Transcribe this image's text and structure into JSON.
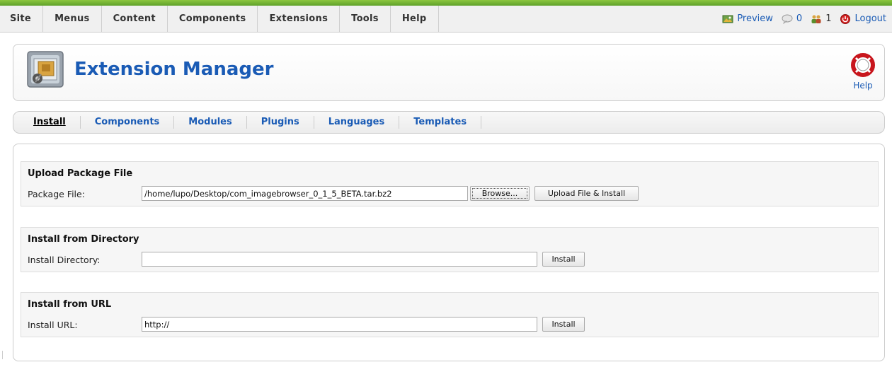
{
  "menubar": {
    "items": [
      "Site",
      "Menus",
      "Content",
      "Components",
      "Extensions",
      "Tools",
      "Help"
    ],
    "preview_label": "Preview",
    "messages_count": "0",
    "users_count": "1",
    "logout_label": "Logout"
  },
  "header": {
    "title": "Extension Manager",
    "help_label": "Help"
  },
  "tabs": [
    "Install",
    "Components",
    "Modules",
    "Plugins",
    "Languages",
    "Templates"
  ],
  "upload": {
    "title": "Upload Package File",
    "label": "Package File:",
    "value": "/home/lupo/Desktop/com_imagebrowser_0_1_5_BETA.tar.bz2",
    "browse_label": "Browse...",
    "submit_label": "Upload File & Install"
  },
  "directory": {
    "title": "Install from Directory",
    "label": "Install Directory:",
    "value": "",
    "submit_label": "Install"
  },
  "url": {
    "title": "Install from URL",
    "label": "Install URL:",
    "value": "http://",
    "submit_label": "Install"
  },
  "colors": {
    "accent": "#1a5bb5",
    "topbar": "#8cc63f"
  }
}
